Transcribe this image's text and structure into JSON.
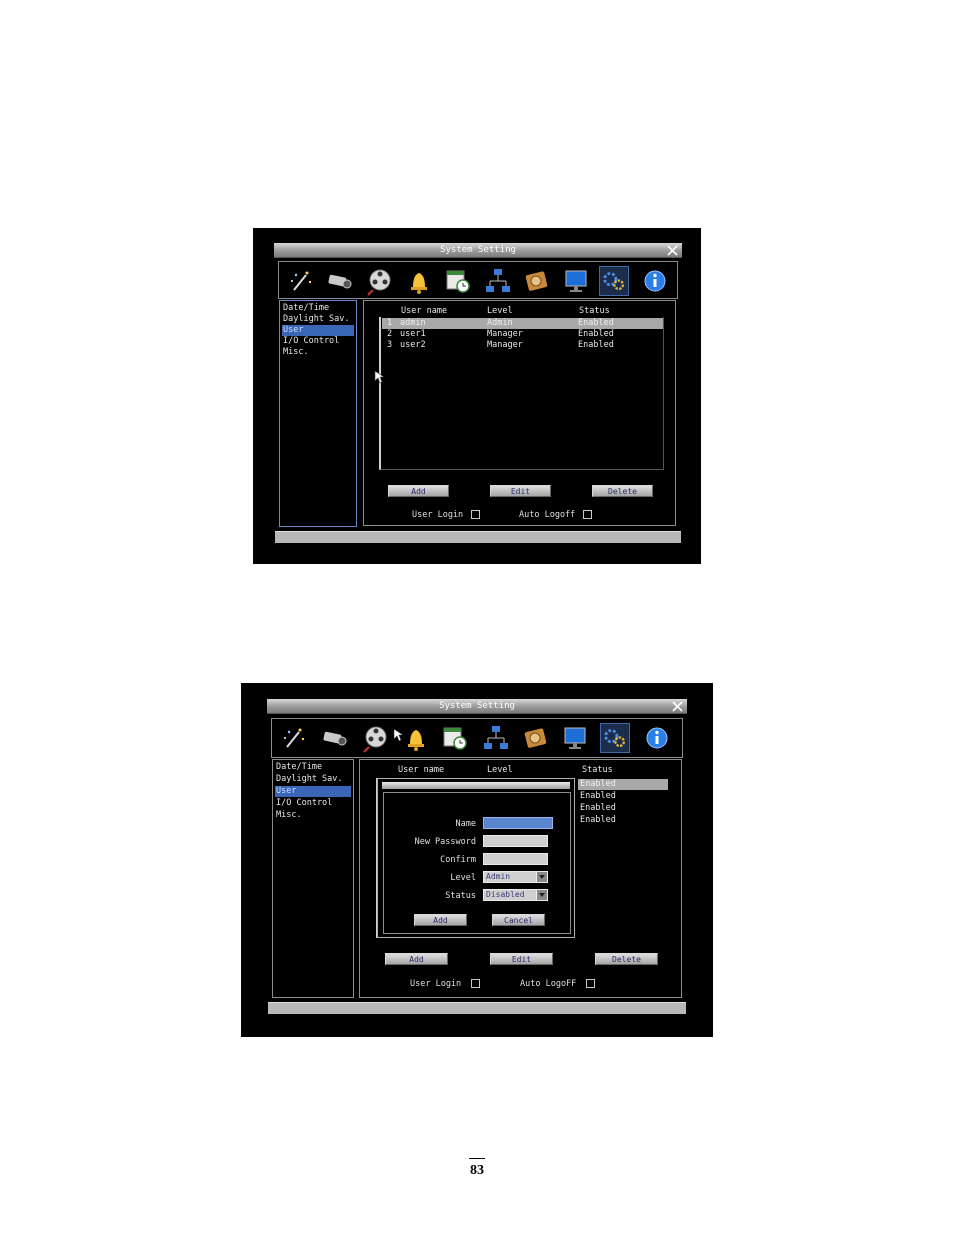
{
  "window_title": "System Setting",
  "sidebar": {
    "items": [
      {
        "label": "Date/Time"
      },
      {
        "label": "Daylight Sav."
      },
      {
        "label": "User",
        "selected": true
      },
      {
        "label": "I/O Control"
      },
      {
        "label": "Misc."
      }
    ]
  },
  "toolbar": {
    "icons": [
      "wizard-icon",
      "camera-icon",
      "film-reel-icon",
      "alarm-bell-icon",
      "schedule-icon",
      "network-icon",
      "disk-icon",
      "monitor-icon",
      "system-gears-icon",
      "info-icon"
    ],
    "active_icon": "system-gears-icon"
  },
  "user_table": {
    "headers": {
      "name": "User name",
      "level": "Level",
      "status": "Status"
    },
    "rows": [
      {
        "index": "1",
        "name": "admin",
        "level": "Admin",
        "status": "Enabled"
      },
      {
        "index": "2",
        "name": "user1",
        "level": "Manager",
        "status": "Enabled"
      },
      {
        "index": "3",
        "name": "user2",
        "level": "Manager",
        "status": "Enabled"
      }
    ]
  },
  "buttons": {
    "add": "Add",
    "edit": "Edit",
    "delete": "Delete"
  },
  "options": {
    "user_login": "User Login",
    "auto_logoff_1": "Auto Logoff",
    "auto_logoff_2": "Auto LogoFF"
  },
  "screen2_statuses": [
    "Enabled",
    "Enabled",
    "Enabled",
    "Enabled"
  ],
  "add_dialog": {
    "labels": {
      "name": "Name",
      "new_password": "New Password",
      "confirm": "Confirm",
      "level": "Level",
      "status": "Status"
    },
    "level_value": "Admin",
    "status_value": "Disabled",
    "add_button": "Add",
    "cancel_button": "Cancel"
  },
  "page_number": "83"
}
